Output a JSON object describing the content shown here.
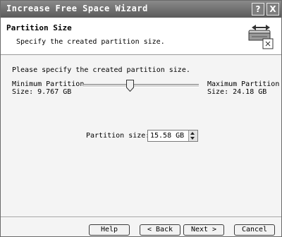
{
  "window": {
    "title": "Increase Free Space Wizard",
    "help_glyph": "?",
    "close_glyph": "X"
  },
  "header": {
    "title": "Partition Size",
    "subtitle": "Specify the created partition size.",
    "icon": "partition-resize-icon"
  },
  "body": {
    "prompt": "Please specify the created partition size.",
    "min_label_line1": "Minimum Partition",
    "min_label_line2": "Size: 9.767 GB",
    "max_label_line1": "Maximum Partition",
    "max_label_line2": "Size: 24.18 GB",
    "slider_fraction": 0.4,
    "partition_size_label": "Partition size:",
    "partition_size_value": "15.58 GB"
  },
  "buttons": {
    "help": "Help",
    "back": "< Back",
    "next": "Next >",
    "cancel": "Cancel"
  }
}
